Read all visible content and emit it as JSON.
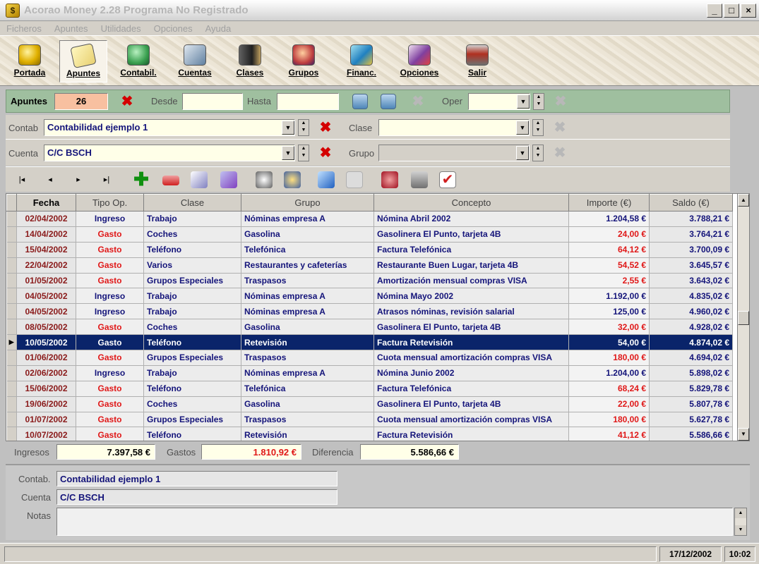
{
  "window": {
    "title": "Acorao Money 2.28 Programa No Registrado"
  },
  "menu": [
    "Ficheros",
    "Apuntes",
    "Utilidades",
    "Opciones",
    "Ayuda"
  ],
  "toolbar": [
    {
      "label": "Portada",
      "icon": "coins-icon",
      "color": "#e0b000"
    },
    {
      "label": "Apuntes",
      "icon": "notes-icon",
      "color": "#e8d070"
    },
    {
      "label": "Contabil.",
      "icon": "accounting-icon",
      "color": "#3aa050"
    },
    {
      "label": "Cuentas",
      "icon": "accounts-icon",
      "color": "#6080a0"
    },
    {
      "label": "Clases",
      "icon": "classes-icon",
      "color": "#404040"
    },
    {
      "label": "Grupos",
      "icon": "groups-icon",
      "color": "#c04040"
    },
    {
      "label": "Financ.",
      "icon": "finance-icon",
      "color": "#2080c0"
    },
    {
      "label": "Opciones",
      "icon": "options-icon",
      "color": "#8040a0"
    },
    {
      "label": "Salir",
      "icon": "exit-icon",
      "color": "#b03020"
    }
  ],
  "filters": {
    "apuntes_label": "Apuntes",
    "apuntes_count": "26",
    "desde_label": "Desde",
    "desde_value": "",
    "hasta_label": "Hasta",
    "hasta_value": "",
    "oper_label": "Oper",
    "oper_value": "",
    "contab_label": "Contab",
    "contab_value": "Contabilidad ejemplo 1",
    "clase_label": "Clase",
    "clase_value": "",
    "cuenta_label": "Cuenta",
    "cuenta_value": "C/C BSCH",
    "grupo_label": "Grupo",
    "grupo_value": ""
  },
  "nav": {
    "first": "|◂",
    "prev": "◂",
    "next": "▸",
    "last": "▸|"
  },
  "grid": {
    "columns": [
      "Fecha",
      "Tipo Op.",
      "Clase",
      "Grupo",
      "Concepto",
      "Importe (€)",
      "Saldo (€)"
    ],
    "rows": [
      {
        "fecha": "02/04/2002",
        "tipo": "Ingreso",
        "clase": "Trabajo",
        "grupo": "Nóminas empresa A",
        "concepto": "Nómina Abril 2002",
        "importe": "1.204,58 €",
        "saldo": "3.788,21 €"
      },
      {
        "fecha": "14/04/2002",
        "tipo": "Gasto",
        "clase": "Coches",
        "grupo": "Gasolina",
        "concepto": "Gasolinera El Punto, tarjeta 4B",
        "importe": "24,00 €",
        "saldo": "3.764,21 €"
      },
      {
        "fecha": "15/04/2002",
        "tipo": "Gasto",
        "clase": "Teléfono",
        "grupo": "Telefónica",
        "concepto": "Factura Telefónica",
        "importe": "64,12 €",
        "saldo": "3.700,09 €"
      },
      {
        "fecha": "22/04/2002",
        "tipo": "Gasto",
        "clase": "Varios",
        "grupo": "Restaurantes y cafeterías",
        "concepto": "Restaurante Buen Lugar, tarjeta 4B",
        "importe": "54,52 €",
        "saldo": "3.645,57 €"
      },
      {
        "fecha": "01/05/2002",
        "tipo": "Gasto",
        "clase": "Grupos Especiales",
        "grupo": "Traspasos",
        "concepto": "Amortización mensual compras VISA",
        "importe": "2,55 €",
        "saldo": "3.643,02 €"
      },
      {
        "fecha": "04/05/2002",
        "tipo": "Ingreso",
        "clase": "Trabajo",
        "grupo": "Nóminas empresa A",
        "concepto": "Nómina Mayo 2002",
        "importe": "1.192,00 €",
        "saldo": "4.835,02 €"
      },
      {
        "fecha": "04/05/2002",
        "tipo": "Ingreso",
        "clase": "Trabajo",
        "grupo": "Nóminas empresa A",
        "concepto": "Atrasos nóminas, revisión salarial",
        "importe": "125,00 €",
        "saldo": "4.960,02 €"
      },
      {
        "fecha": "08/05/2002",
        "tipo": "Gasto",
        "clase": "Coches",
        "grupo": "Gasolina",
        "concepto": "Gasolinera El Punto, tarjeta 4B",
        "importe": "32,00 €",
        "saldo": "4.928,02 €"
      },
      {
        "fecha": "10/05/2002",
        "tipo": "Gasto",
        "clase": "Teléfono",
        "grupo": "Retevisión",
        "concepto": "Factura Retevisión",
        "importe": "54,00 €",
        "saldo": "4.874,02 €",
        "selected": true
      },
      {
        "fecha": "01/06/2002",
        "tipo": "Gasto",
        "clase": "Grupos Especiales",
        "grupo": "Traspasos",
        "concepto": "Cuota mensual amortización compras VISA",
        "importe": "180,00 €",
        "saldo": "4.694,02 €"
      },
      {
        "fecha": "02/06/2002",
        "tipo": "Ingreso",
        "clase": "Trabajo",
        "grupo": "Nóminas empresa A",
        "concepto": "Nómina Junio 2002",
        "importe": "1.204,00 €",
        "saldo": "5.898,02 €"
      },
      {
        "fecha": "15/06/2002",
        "tipo": "Gasto",
        "clase": "Teléfono",
        "grupo": "Telefónica",
        "concepto": "Factura Telefónica",
        "importe": "68,24 €",
        "saldo": "5.829,78 €"
      },
      {
        "fecha": "19/06/2002",
        "tipo": "Gasto",
        "clase": "Coches",
        "grupo": "Gasolina",
        "concepto": "Gasolinera El Punto, tarjeta 4B",
        "importe": "22,00 €",
        "saldo": "5.807,78 €"
      },
      {
        "fecha": "01/07/2002",
        "tipo": "Gasto",
        "clase": "Grupos Especiales",
        "grupo": "Traspasos",
        "concepto": "Cuota mensual amortización compras VISA",
        "importe": "180,00 €",
        "saldo": "5.627,78 €"
      },
      {
        "fecha": "10/07/2002",
        "tipo": "Gasto",
        "clase": "Teléfono",
        "grupo": "Retevisión",
        "concepto": "Factura Retevisión",
        "importe": "41,12 €",
        "saldo": "5.586,66 €"
      }
    ]
  },
  "totals": {
    "ingresos_label": "Ingresos",
    "ingresos_value": "7.397,58 €",
    "gastos_label": "Gastos",
    "gastos_value": "1.810,92 €",
    "diferencia_label": "Diferencia",
    "diferencia_value": "5.586,66 €"
  },
  "detail": {
    "contab_label": "Contab.",
    "contab_value": "Contabilidad ejemplo 1",
    "cuenta_label": "Cuenta",
    "cuenta_value": "C/C BSCH",
    "notas_label": "Notas",
    "notas_value": ""
  },
  "status": {
    "date": "17/12/2002",
    "time": "10:02"
  },
  "colors": {
    "ingreso": "#14147a",
    "gasto": "#e01818",
    "selection": "#0a246a",
    "filter_bar": "#9fbf9f"
  }
}
